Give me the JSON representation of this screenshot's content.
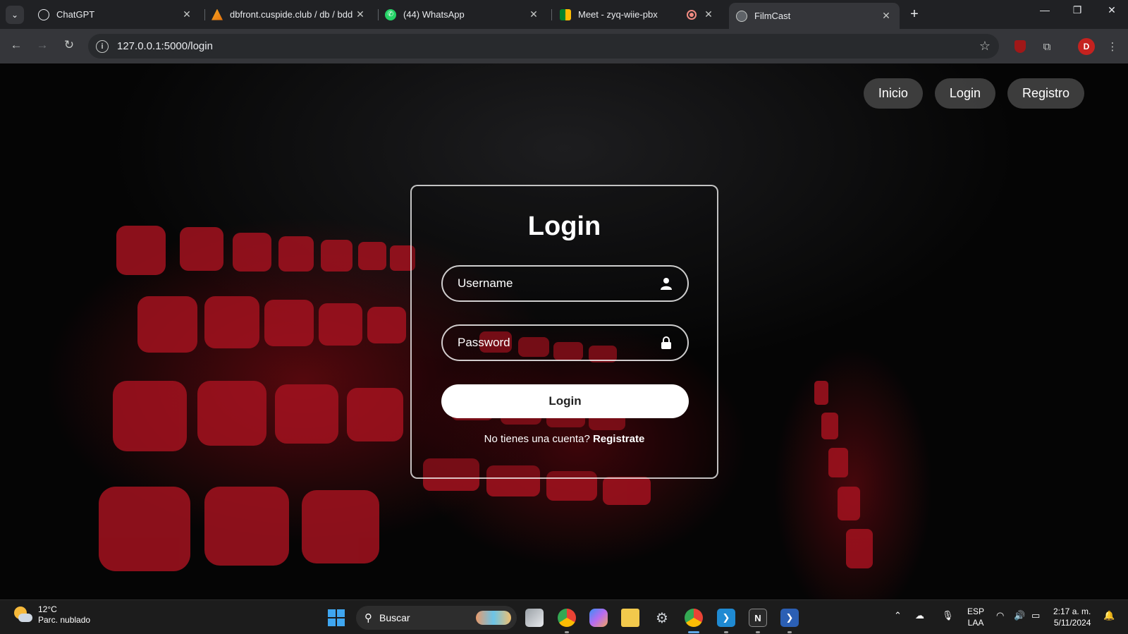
{
  "browser": {
    "tabs": [
      {
        "title": "ChatGPT",
        "icon": "chatgpt-icon"
      },
      {
        "title": "dbfront.cuspide.club / db / bdd",
        "icon": "dbfront-icon"
      },
      {
        "title": "(44) WhatsApp",
        "icon": "whatsapp-icon"
      },
      {
        "title": "Meet - zyq-wiie-pbx",
        "icon": "meet-icon"
      },
      {
        "title": "FilmCast",
        "icon": "globe-icon",
        "active": true
      }
    ],
    "url": "127.0.0.1:5000/login",
    "profile_initial": "D"
  },
  "nav": {
    "inicio": "Inicio",
    "login": "Login",
    "registro": "Registro"
  },
  "login": {
    "title": "Login",
    "username_placeholder": "Username",
    "password_placeholder": "Password",
    "submit": "Login",
    "no_account": "No tienes una cuenta?",
    "register_link": "Registrate"
  },
  "taskbar": {
    "temperature": "12°C",
    "weather": "Parc. nublado",
    "search": "Buscar",
    "lang_top": "ESP",
    "lang_bottom": "LAA",
    "time": "2:17 a. m.",
    "date": "5/11/2024"
  },
  "colors": {
    "accent_red": "#b3101d",
    "chrome_bg": "#202124",
    "windows_blue": "#3fa6f0"
  }
}
